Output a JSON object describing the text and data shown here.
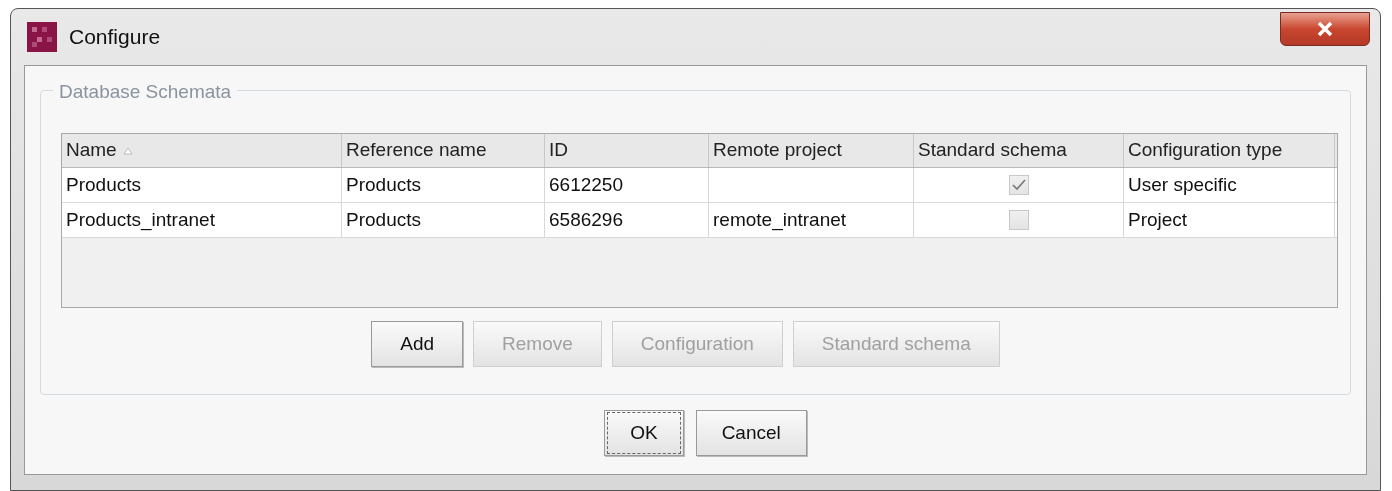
{
  "window": {
    "title": "Configure"
  },
  "group": {
    "title": "Database Schemata"
  },
  "table": {
    "columns": [
      {
        "label": "Name",
        "sorted": true
      },
      {
        "label": "Reference name",
        "sorted": false
      },
      {
        "label": "ID",
        "sorted": false
      },
      {
        "label": "Remote project",
        "sorted": false
      },
      {
        "label": "Standard schema",
        "sorted": false
      },
      {
        "label": "Configuration type",
        "sorted": false
      }
    ],
    "rows": [
      {
        "name": "Products",
        "reference_name": "Products",
        "id": "6612250",
        "remote_project": "",
        "standard_schema": {
          "checked": true
        },
        "configuration_type": "User specific"
      },
      {
        "name": "Products_intranet",
        "reference_name": "Products",
        "id": "6586296",
        "remote_project": "remote_intranet",
        "standard_schema": {
          "checked": false
        },
        "configuration_type": "Project"
      }
    ]
  },
  "table_buttons": [
    {
      "label": "Add",
      "disabled": false
    },
    {
      "label": "Remove",
      "disabled": true
    },
    {
      "label": "Configuration",
      "disabled": true
    },
    {
      "label": "Standard schema",
      "disabled": true
    }
  ],
  "dialog_buttons": [
    {
      "label": "OK",
      "focused": true
    },
    {
      "label": "Cancel",
      "focused": false
    }
  ]
}
